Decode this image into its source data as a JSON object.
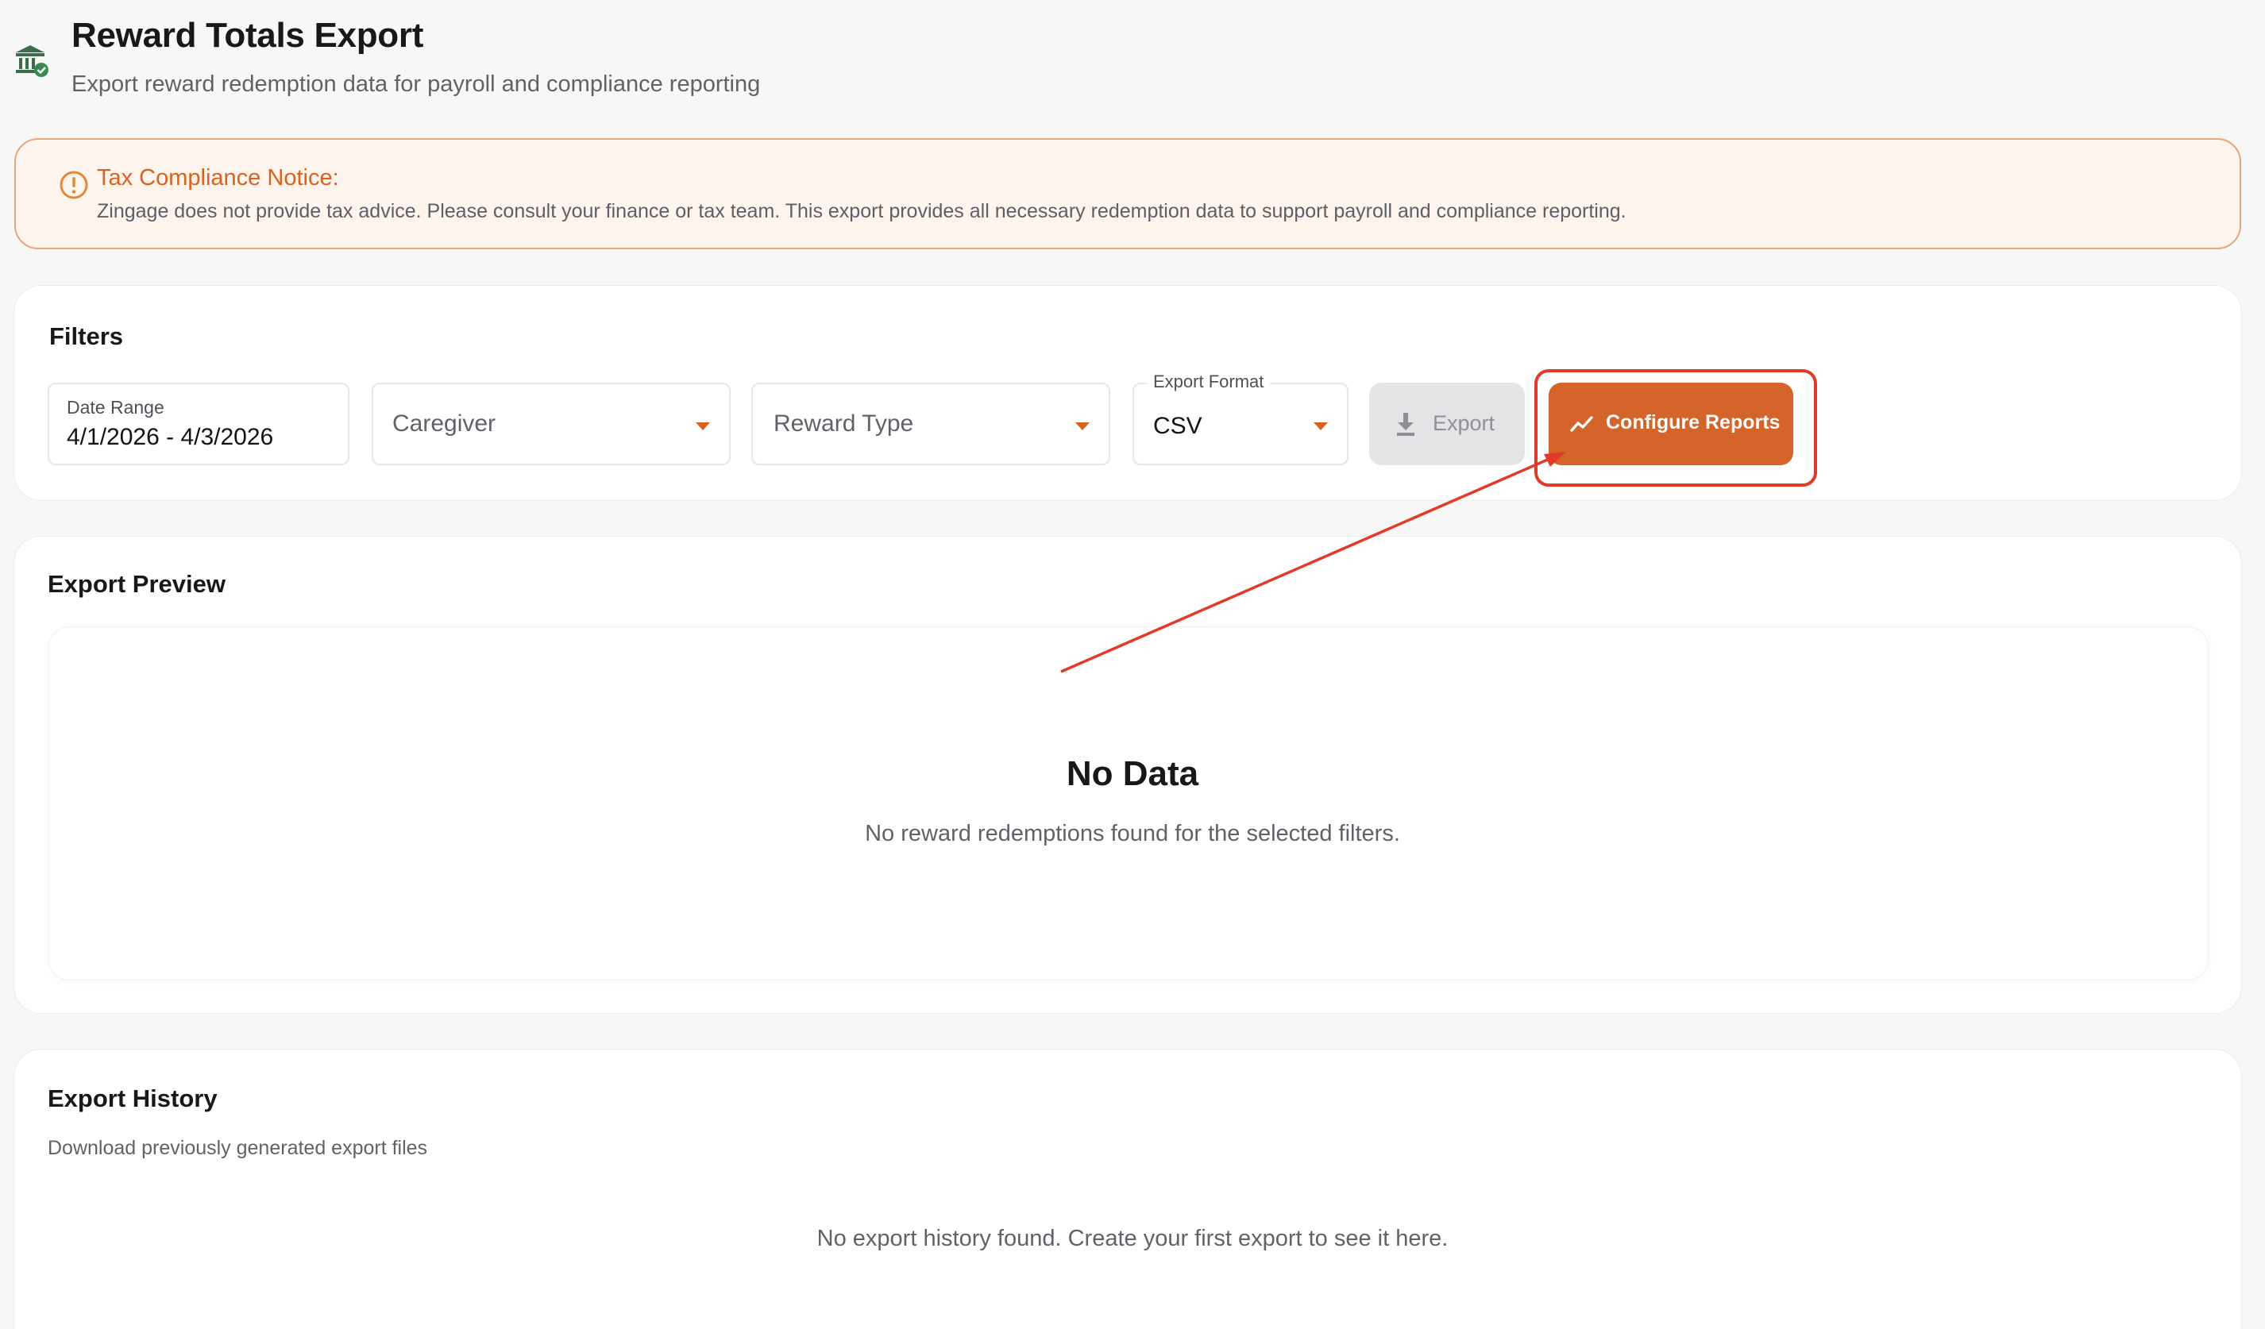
{
  "header": {
    "title": "Reward Totals Export",
    "subtitle": "Export reward redemption data for payroll and compliance reporting",
    "icon": "bank-check-icon"
  },
  "notice": {
    "title": "Tax Compliance Notice:",
    "text": "Zingage does not provide tax advice. Please consult your finance or tax team. This export provides all necessary redemption data to support payroll and compliance reporting.",
    "icon": "alert-circle-icon"
  },
  "filters": {
    "title": "Filters",
    "date_range": {
      "label": "Date Range",
      "value": "4/1/2026 - 4/3/2026"
    },
    "caregiver": {
      "placeholder": "Caregiver"
    },
    "reward_type": {
      "placeholder": "Reward Type"
    },
    "export_format": {
      "label": "Export Format",
      "value": "CSV"
    },
    "export_button": "Export",
    "configure_button": "Configure Reports"
  },
  "preview": {
    "title": "Export Preview",
    "empty_title": "No Data",
    "empty_text": "No reward redemptions found for the selected filters."
  },
  "history": {
    "title": "Export History",
    "subtitle": "Download previously generated export files",
    "empty_text": "No export history found. Create your first export to see it here."
  },
  "colors": {
    "accent": "#d4642a",
    "notice_text": "#d9621f",
    "annotation": "#e23a2a",
    "header_icon": "#3a8a4e"
  }
}
